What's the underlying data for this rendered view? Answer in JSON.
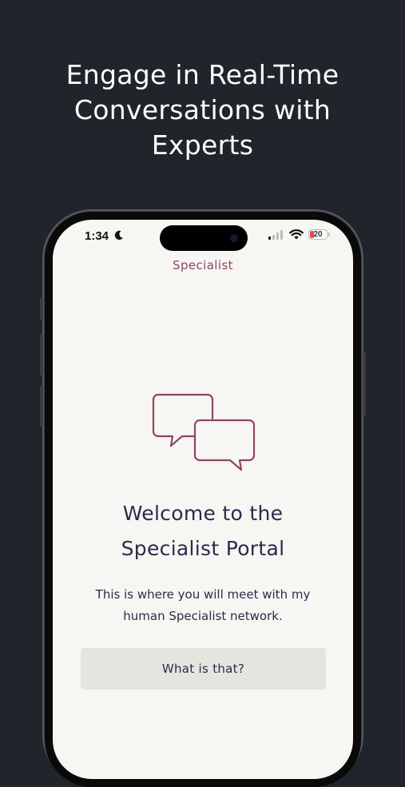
{
  "headline": {
    "line1": "Engage in Real-Time",
    "line2": "Conversations with",
    "line3": "Experts"
  },
  "status_bar": {
    "time": "1:34",
    "battery_level": "20",
    "icons": [
      "moon-icon",
      "signal-icon",
      "wifi-icon",
      "battery-icon"
    ]
  },
  "nav": {
    "title": "Specialist"
  },
  "hero": {
    "icon": "chat-bubbles-icon",
    "title_line1": "Welcome to the",
    "title_line2": "Specialist Portal"
  },
  "description": {
    "line1": "This is where you will meet with my",
    "line2": "human Specialist network."
  },
  "cta": {
    "label": "What is that?"
  },
  "colors": {
    "background": "#20252c",
    "screen": "#f8f6f3",
    "accent": "#8a4766",
    "text": "#2d2a4a",
    "button": "#e2e6df"
  }
}
